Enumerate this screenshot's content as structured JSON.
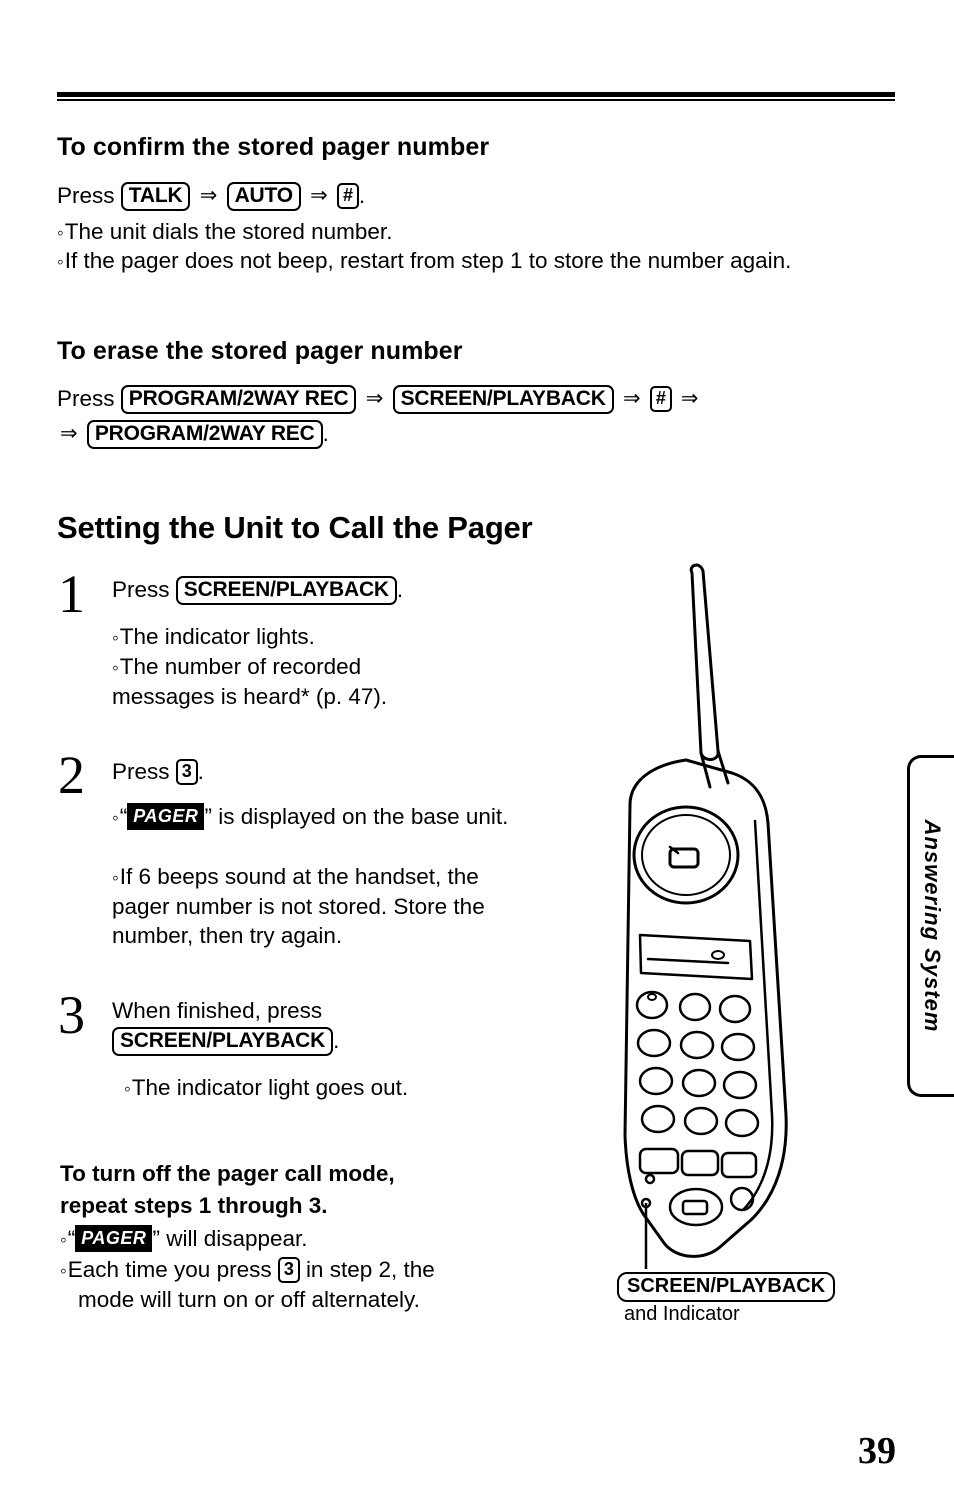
{
  "sections": [
    {
      "heading": "To confirm the stored pager number",
      "press_label": "Press",
      "keys": [
        "TALK",
        "AUTO",
        "#"
      ],
      "bullets": [
        "The unit dials the stored number.",
        "If the pager does not beep, restart from step 1 to store the number again."
      ]
    },
    {
      "heading": "To erase the stored pager number",
      "press_label": "Press",
      "keys": [
        "PROGRAM/2WAY REC",
        "SCREEN/PLAYBACK",
        "#",
        "PROGRAM/2WAY REC"
      ]
    }
  ],
  "chapter_title": "Setting the Unit to Call the Pager",
  "steps": [
    {
      "num": "1",
      "press_label": "Press",
      "key": "SCREEN/PLAYBACK",
      "bullets": [
        "The indicator lights.",
        "The number of recorded messages is heard* (p. 47)."
      ]
    },
    {
      "num": "2",
      "press_label": "Press",
      "key": "3",
      "badge": "PAGER",
      "bullets": [
        "is displayed on the base unit.",
        "If 6 beeps sound at the handset, the pager number is not stored. Store the number, then try again."
      ]
    },
    {
      "num": "3",
      "press_label": "When finished, press",
      "key": "SCREEN/PLAYBACK",
      "bullets": [
        "The indicator light goes out."
      ]
    }
  ],
  "note": {
    "heading_line1": "To turn off the pager call mode,",
    "heading_line2": "repeat steps 1 through 3.",
    "badge": "PAGER",
    "bullet1_tail": "will disappear.",
    "bullet2_pre": "Each time you press",
    "bullet2_key": "3",
    "bullet2_post": "in step 2, the",
    "bullet2_line2": "mode will turn on or off alternately."
  },
  "callout": {
    "label": "SCREEN/PLAYBACK",
    "sub": "and Indicator"
  },
  "side_tab": {
    "text": "Answering System"
  },
  "page_number": "39"
}
